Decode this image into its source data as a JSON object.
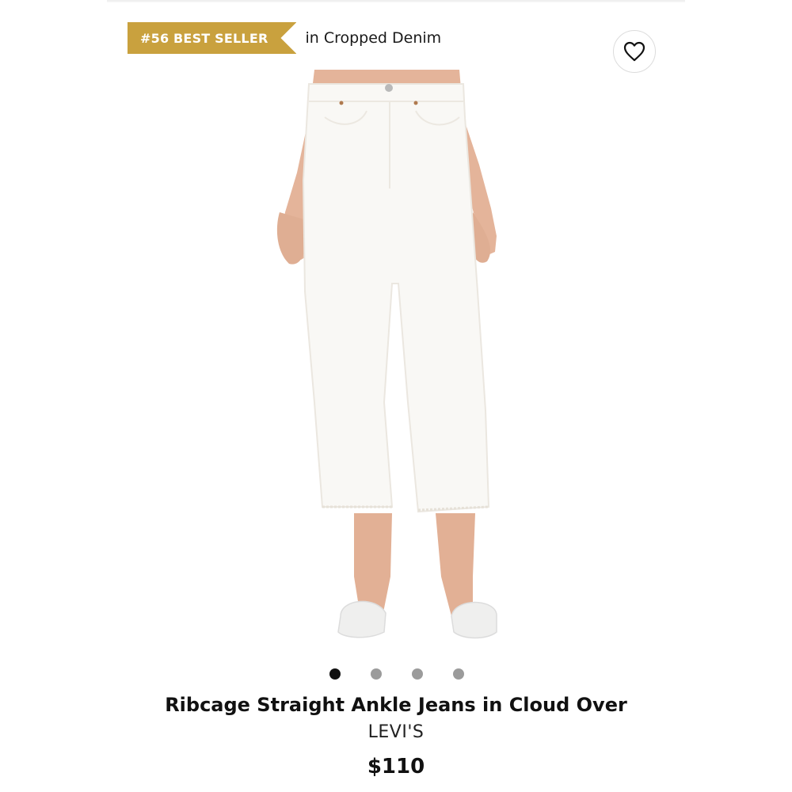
{
  "badge": {
    "rank_label": "#56 BEST SELLER",
    "context": "in Cropped Denim",
    "color": "#c9a13e"
  },
  "favorite": {
    "icon": "heart-icon"
  },
  "gallery": {
    "image_description_icon": "product-photo",
    "dots": [
      {
        "active": true
      },
      {
        "active": false
      },
      {
        "active": false
      },
      {
        "active": false
      }
    ]
  },
  "product": {
    "title": "Ribcage Straight Ankle Jeans in Cloud Over",
    "brand": "LEVI'S",
    "price": "$110"
  }
}
